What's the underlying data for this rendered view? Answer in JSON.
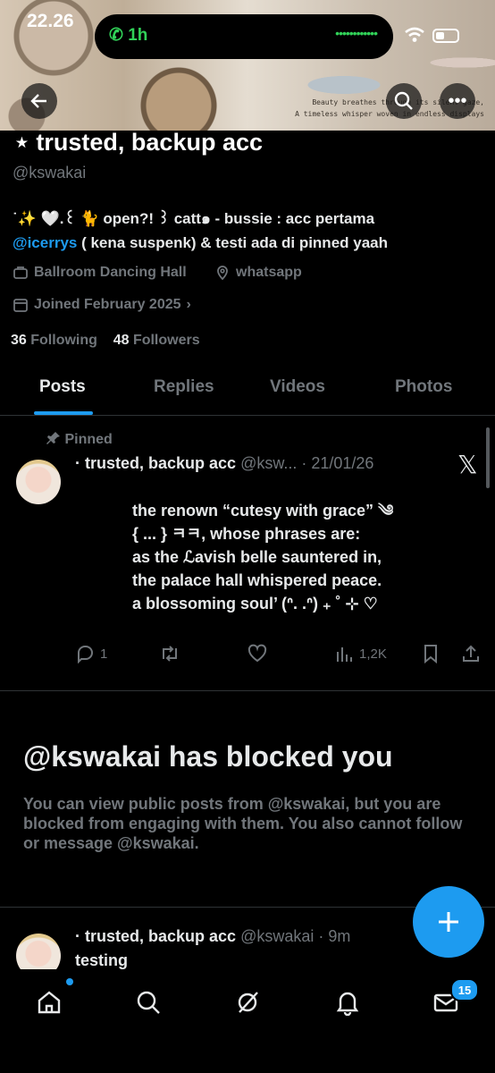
{
  "status_bar": {
    "time": "22.26",
    "call_duration": "1h"
  },
  "banner": {
    "caption_line1": "Beauty breathes through its silent gaze,",
    "caption_line2": "A timeless whisper woven in endless displays"
  },
  "profile": {
    "name": "⋆ trusted, backup acc",
    "handle": "@kswakai",
    "bio_line1": "˙✨ 🤍.꒰ 🐈 open?! ꒱ catt๑ - bussie : acc pertama",
    "bio_mention": "@icerrys",
    "bio_line2_rest": " ( kena suspenk) & testi ada di pinned yaah",
    "location": "Ballroom Dancing Hall",
    "website": "whatsapp",
    "joined": "Joined February 2025",
    "following_count": "36",
    "following_label": "Following",
    "followers_count": "48",
    "followers_label": "Followers"
  },
  "tabs": [
    "Posts",
    "Replies",
    "Videos",
    "Photos"
  ],
  "pinned_post": {
    "pinned_label": "Pinned",
    "author_name": "· trusted, backup acc",
    "author_handle": "@ksw...",
    "date": "· 21/01/26",
    "body_line1": "the renown “cutesy with grace” ༄",
    "body_line2": "{ ... } ㅋㅋ, whose phrases are:",
    "body_line3": "as the ℒavish belle sauntered in,",
    "body_line4": "the palace hall whispered peace.",
    "body_line5": "a blossoming soul’ (ᐢ. .ᐢ) ₊ ˚ ⊹ ♡",
    "replies": "1",
    "views": "1,2K"
  },
  "blocked": {
    "title": "@kswakai has blocked you",
    "text": "You can view public posts from @kswakai, but you are blocked from engaging with them. You also cannot follow or message @kswakai."
  },
  "second_post": {
    "author_name": "· trusted, backup acc",
    "author_handle": "@kswakai",
    "time": "· 9m",
    "text": "testing"
  },
  "nav": {
    "messages_badge": "15"
  },
  "colors": {
    "accent": "#1d9bf0",
    "background": "#000000",
    "muted": "#71767b",
    "call_green": "#31d158"
  }
}
